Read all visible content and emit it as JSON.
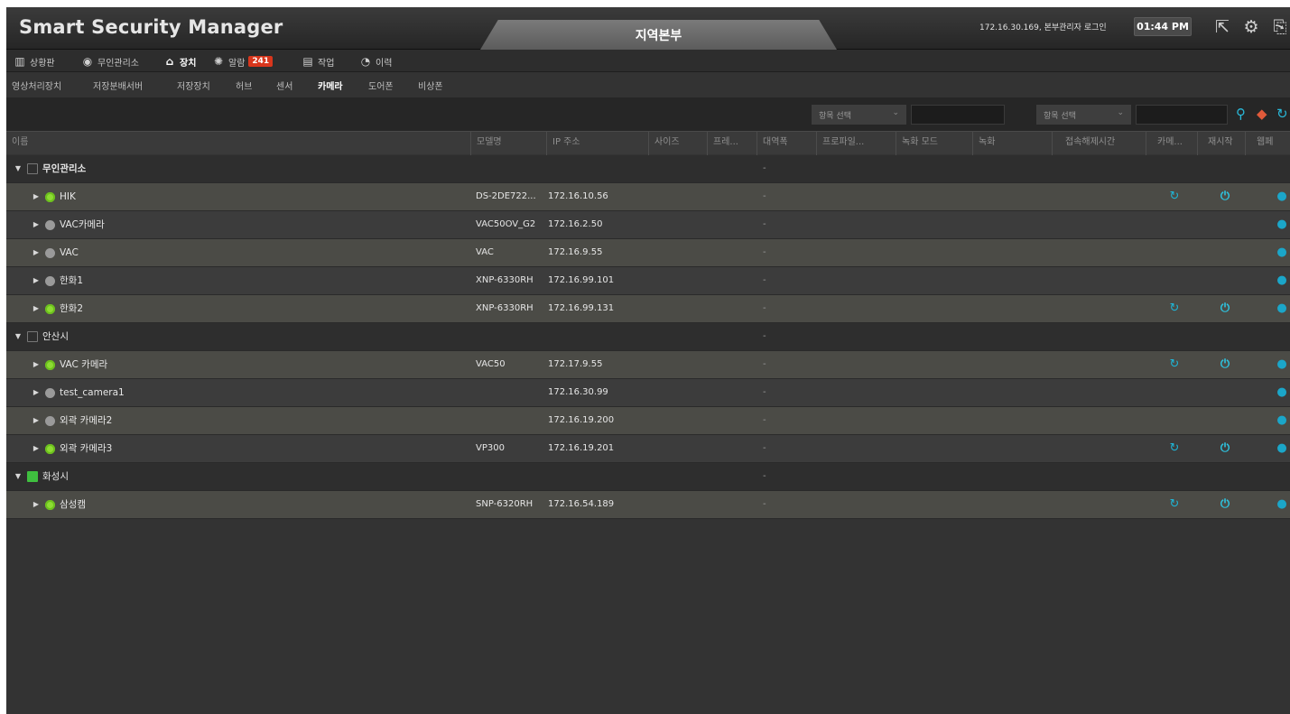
{
  "titlebar": {
    "app_title": "Smart Security Manager",
    "region_tab": "지역본부",
    "login_info": "172.16.30.169, 본부관리자 로그인",
    "clock": "01:44 PM"
  },
  "main_menu": [
    {
      "label": "상황판",
      "icon": "chart-bars-icon"
    },
    {
      "label": "무인관리소",
      "icon": "globe-icon"
    },
    {
      "label": "장치",
      "icon": "device-icon"
    },
    {
      "label": "알람",
      "icon": "alarm-icon",
      "badge": "241"
    },
    {
      "label": "작업",
      "icon": "document-icon"
    },
    {
      "label": "이력",
      "icon": "clock-icon"
    }
  ],
  "sub_menu": [
    "영상처리장치",
    "저장분배서버",
    "저장장치",
    "허브",
    "센서",
    "카메라",
    "도어폰",
    "비상폰"
  ],
  "active_sub_menu": "카메라",
  "filters": {
    "select1": "항목 선택",
    "select2": "항목 선택"
  },
  "columns": [
    "이름",
    "모델명",
    "IP 주소",
    "사이즈",
    "프레...",
    "대역폭",
    "프로파일...",
    "녹화 모드",
    "녹화",
    "접속해제시간",
    "카메...",
    "재시작",
    "웹페"
  ],
  "groups": [
    {
      "name": "무인관리소",
      "bandwidth": "-",
      "active": false,
      "devices": [
        {
          "name": "HIK",
          "model": "DS-2DE722...",
          "ip": "172.16.10.56",
          "bandwidth": "-",
          "online": true,
          "actions": true
        },
        {
          "name": "VAC카메라",
          "model": "VAC50OV_G2",
          "ip": "172.16.2.50",
          "bandwidth": "-",
          "online": false,
          "actions": false
        },
        {
          "name": "VAC",
          "model": "VAC",
          "ip": "172.16.9.55",
          "bandwidth": "-",
          "online": false,
          "actions": false
        },
        {
          "name": "한화1",
          "model": "XNP-6330RH",
          "ip": "172.16.99.101",
          "bandwidth": "-",
          "online": false,
          "actions": false
        },
        {
          "name": "한화2",
          "model": "XNP-6330RH",
          "ip": "172.16.99.131",
          "bandwidth": "-",
          "online": true,
          "actions": true
        }
      ]
    },
    {
      "name": "안산시",
      "bandwidth": "-",
      "active": false,
      "devices": [
        {
          "name": "VAC 카메라",
          "model": "VAC50",
          "ip": "172.17.9.55",
          "bandwidth": "-",
          "online": true,
          "actions": true
        },
        {
          "name": "test_camera1",
          "model": "",
          "ip": "172.16.30.99",
          "bandwidth": "-",
          "online": false,
          "actions": false
        },
        {
          "name": "외곽 카메라2",
          "model": "",
          "ip": "172.16.19.200",
          "bandwidth": "-",
          "online": false,
          "actions": false
        },
        {
          "name": "외곽 카메라3",
          "model": "VP300",
          "ip": "172.16.19.201",
          "bandwidth": "-",
          "online": true,
          "actions": true
        }
      ]
    },
    {
      "name": "화성시",
      "bandwidth": "-",
      "active": true,
      "devices": [
        {
          "name": "삼성캠",
          "model": "SNP-6320RH",
          "ip": "172.16.54.189",
          "bandwidth": "-",
          "online": true,
          "actions": true
        }
      ]
    }
  ],
  "colors": {
    "accent": "#1fb5d6",
    "online": "#8ddc33",
    "badge": "#d9361c"
  }
}
